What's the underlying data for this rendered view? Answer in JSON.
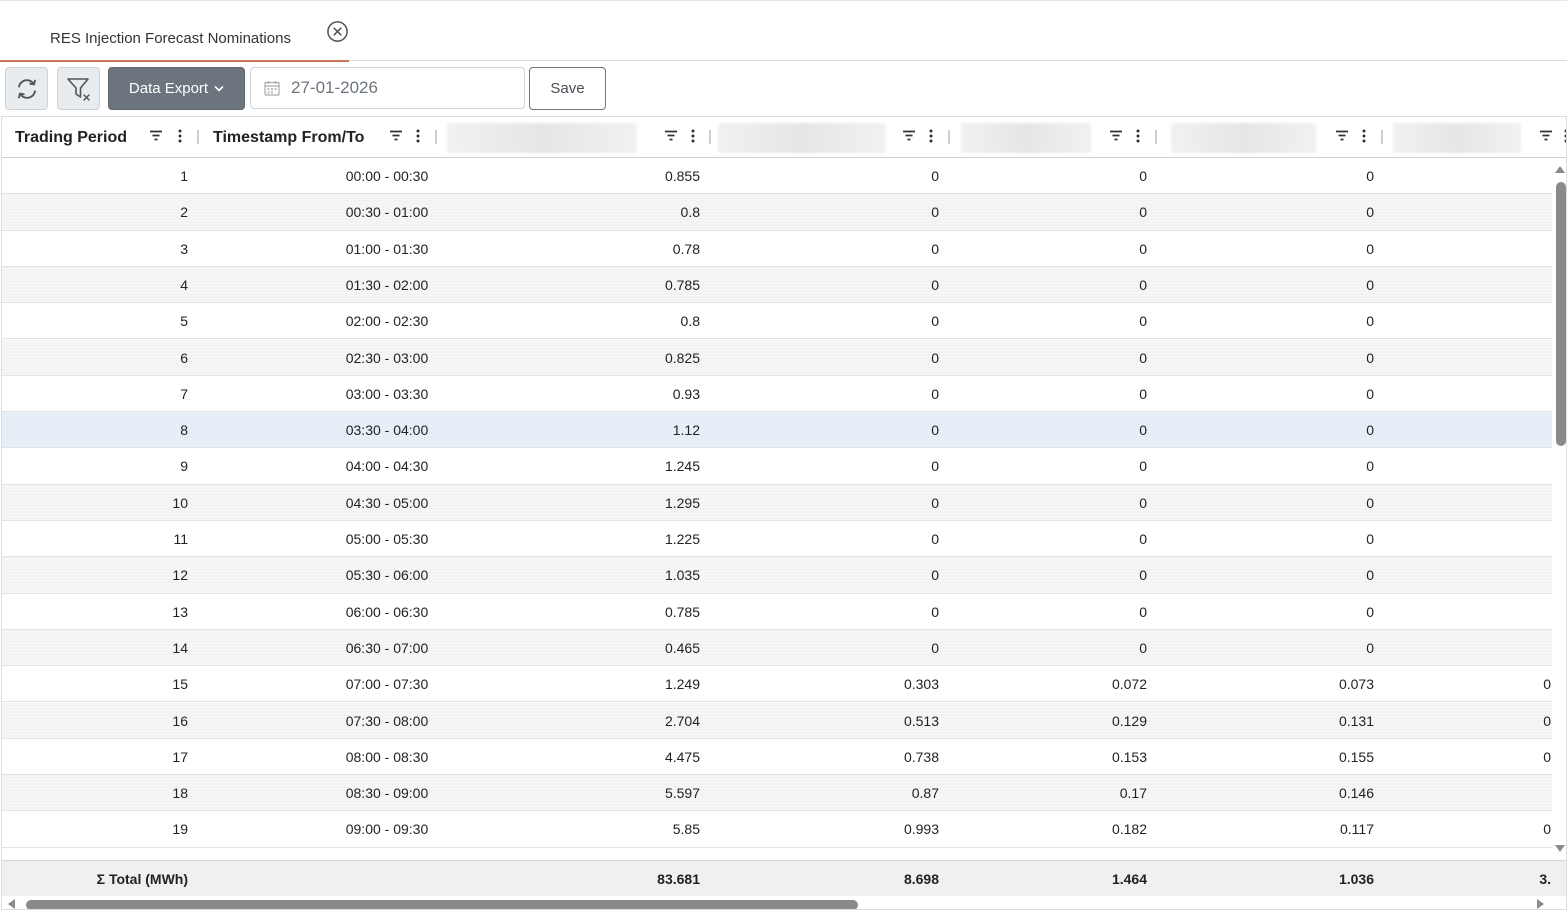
{
  "tab": {
    "label": "RES Injection Forecast Nominations"
  },
  "toolbar": {
    "export_label": "Data Export",
    "date_value": "27-01-2026",
    "save_label": "Save"
  },
  "grid": {
    "columns": [
      "Trading Period",
      "Timestamp From/To",
      "",
      "",
      "",
      "",
      ""
    ],
    "rows": [
      {
        "period": "1",
        "ts": "00:00 - 00:30",
        "v1": "0.855",
        "v2": "0",
        "v3": "0",
        "v4": "0",
        "v5": ""
      },
      {
        "period": "2",
        "ts": "00:30 - 01:00",
        "v1": "0.8",
        "v2": "0",
        "v3": "0",
        "v4": "0",
        "v5": ""
      },
      {
        "period": "3",
        "ts": "01:00 - 01:30",
        "v1": "0.78",
        "v2": "0",
        "v3": "0",
        "v4": "0",
        "v5": ""
      },
      {
        "period": "4",
        "ts": "01:30 - 02:00",
        "v1": "0.785",
        "v2": "0",
        "v3": "0",
        "v4": "0",
        "v5": ""
      },
      {
        "period": "5",
        "ts": "02:00 - 02:30",
        "v1": "0.8",
        "v2": "0",
        "v3": "0",
        "v4": "0",
        "v5": ""
      },
      {
        "period": "6",
        "ts": "02:30 - 03:00",
        "v1": "0.825",
        "v2": "0",
        "v3": "0",
        "v4": "0",
        "v5": ""
      },
      {
        "period": "7",
        "ts": "03:00 - 03:30",
        "v1": "0.93",
        "v2": "0",
        "v3": "0",
        "v4": "0",
        "v5": ""
      },
      {
        "period": "8",
        "ts": "03:30 - 04:00",
        "v1": "1.12",
        "v2": "0",
        "v3": "0",
        "v4": "0",
        "v5": ""
      },
      {
        "period": "9",
        "ts": "04:00 - 04:30",
        "v1": "1.245",
        "v2": "0",
        "v3": "0",
        "v4": "0",
        "v5": ""
      },
      {
        "period": "10",
        "ts": "04:30 - 05:00",
        "v1": "1.295",
        "v2": "0",
        "v3": "0",
        "v4": "0",
        "v5": ""
      },
      {
        "period": "11",
        "ts": "05:00 - 05:30",
        "v1": "1.225",
        "v2": "0",
        "v3": "0",
        "v4": "0",
        "v5": ""
      },
      {
        "period": "12",
        "ts": "05:30 - 06:00",
        "v1": "1.035",
        "v2": "0",
        "v3": "0",
        "v4": "0",
        "v5": ""
      },
      {
        "period": "13",
        "ts": "06:00 - 06:30",
        "v1": "0.785",
        "v2": "0",
        "v3": "0",
        "v4": "0",
        "v5": ""
      },
      {
        "period": "14",
        "ts": "06:30 - 07:00",
        "v1": "0.465",
        "v2": "0",
        "v3": "0",
        "v4": "0",
        "v5": ""
      },
      {
        "period": "15",
        "ts": "07:00 - 07:30",
        "v1": "1.249",
        "v2": "0.303",
        "v3": "0.072",
        "v4": "0.073",
        "v5": "0"
      },
      {
        "period": "16",
        "ts": "07:30 - 08:00",
        "v1": "2.704",
        "v2": "0.513",
        "v3": "0.129",
        "v4": "0.131",
        "v5": "0"
      },
      {
        "period": "17",
        "ts": "08:00 - 08:30",
        "v1": "4.475",
        "v2": "0.738",
        "v3": "0.153",
        "v4": "0.155",
        "v5": "0"
      },
      {
        "period": "18",
        "ts": "08:30 - 09:00",
        "v1": "5.597",
        "v2": "0.87",
        "v3": "0.17",
        "v4": "0.146",
        "v5": ""
      },
      {
        "period": "19",
        "ts": "09:00 - 09:30",
        "v1": "5.85",
        "v2": "0.993",
        "v3": "0.182",
        "v4": "0.117",
        "v5": "0"
      }
    ],
    "selected_period": "8",
    "footer": {
      "label": "Σ Total (MWh)",
      "v1": "83.681",
      "v2": "8.698",
      "v3": "1.464",
      "v4": "1.036",
      "v5": "3."
    }
  },
  "colors": {
    "tab_accent": "#c9765a",
    "export_button": "#6c757d",
    "selected_row": "#e6eff7"
  },
  "icons": [
    "refresh-icon",
    "clear-filter-icon",
    "chevron-down-icon",
    "calendar-icon",
    "close-icon",
    "filter-icon",
    "kebab-menu-icon"
  ]
}
